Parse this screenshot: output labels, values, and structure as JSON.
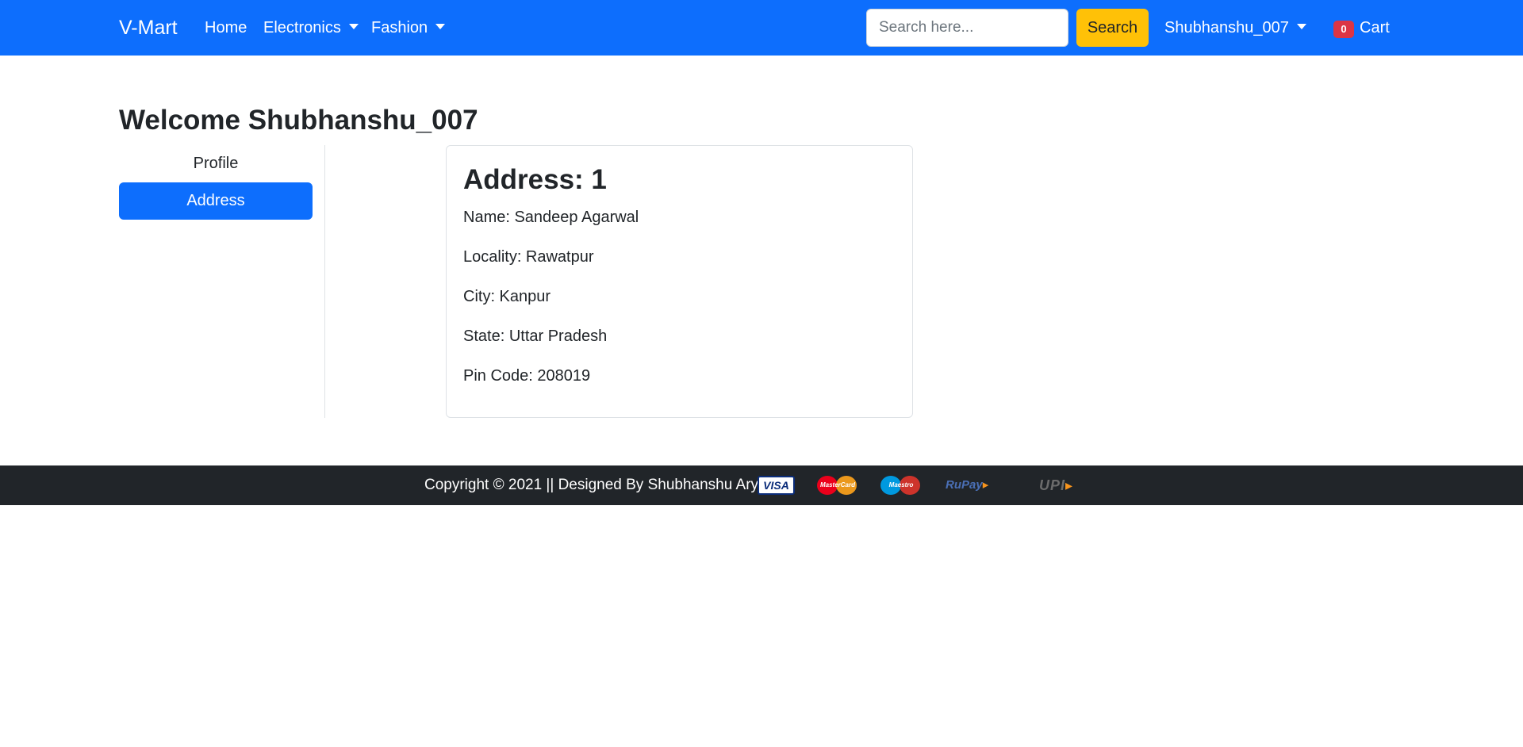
{
  "navbar": {
    "brand": "V-Mart",
    "links": [
      {
        "label": "Home"
      },
      {
        "label": "Electronics"
      },
      {
        "label": "Fashion"
      }
    ],
    "search": {
      "placeholder": "Search here...",
      "value": "",
      "button_label": "Search"
    },
    "user_menu_label": "Shubhanshu_007",
    "cart": {
      "count": "0",
      "label": "Cart"
    }
  },
  "main": {
    "welcome": "Welcome Shubhanshu_007",
    "sidebar": [
      {
        "label": "Profile",
        "active": false
      },
      {
        "label": "Address",
        "active": true
      }
    ],
    "address_card": {
      "title": "Address: 1",
      "lines": [
        "Name: Sandeep Agarwal",
        "Locality: Rawatpur",
        "City: Kanpur",
        "State: Uttar Pradesh",
        "Pin Code: 208019"
      ]
    }
  },
  "footer": {
    "text": "Copyright © 2021 || Designed By Shubhanshu Arya ||",
    "payment_logos": [
      "VISA",
      "MasterCard",
      "Maestro",
      "RuPay",
      "UPI"
    ]
  },
  "colors": {
    "primary": "#0d6efd",
    "search_button": "#ffc107",
    "badge": "#dc3545",
    "footer_bg": "#212529"
  }
}
